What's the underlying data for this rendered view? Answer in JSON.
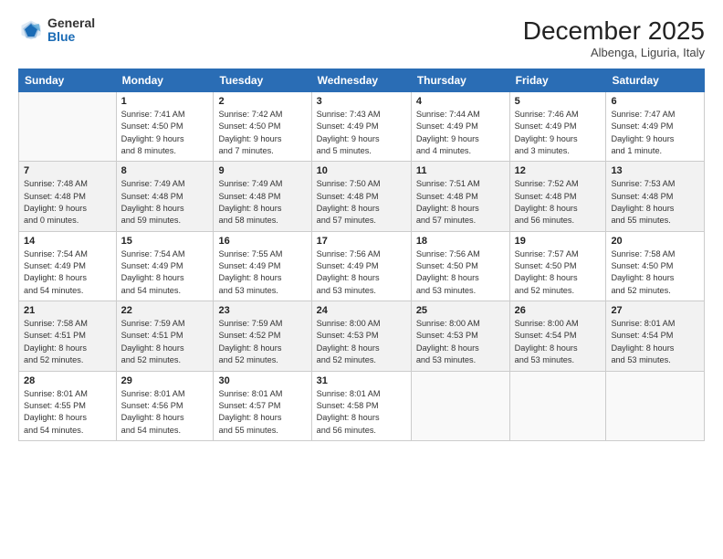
{
  "header": {
    "logo_general": "General",
    "logo_blue": "Blue",
    "month_title": "December 2025",
    "location": "Albenga, Liguria, Italy"
  },
  "days_of_week": [
    "Sunday",
    "Monday",
    "Tuesday",
    "Wednesday",
    "Thursday",
    "Friday",
    "Saturday"
  ],
  "weeks": [
    [
      {
        "day": "",
        "info": ""
      },
      {
        "day": "1",
        "info": "Sunrise: 7:41 AM\nSunset: 4:50 PM\nDaylight: 9 hours\nand 8 minutes."
      },
      {
        "day": "2",
        "info": "Sunrise: 7:42 AM\nSunset: 4:50 PM\nDaylight: 9 hours\nand 7 minutes."
      },
      {
        "day": "3",
        "info": "Sunrise: 7:43 AM\nSunset: 4:49 PM\nDaylight: 9 hours\nand 5 minutes."
      },
      {
        "day": "4",
        "info": "Sunrise: 7:44 AM\nSunset: 4:49 PM\nDaylight: 9 hours\nand 4 minutes."
      },
      {
        "day": "5",
        "info": "Sunrise: 7:46 AM\nSunset: 4:49 PM\nDaylight: 9 hours\nand 3 minutes."
      },
      {
        "day": "6",
        "info": "Sunrise: 7:47 AM\nSunset: 4:49 PM\nDaylight: 9 hours\nand 1 minute."
      }
    ],
    [
      {
        "day": "7",
        "info": "Sunrise: 7:48 AM\nSunset: 4:48 PM\nDaylight: 9 hours\nand 0 minutes."
      },
      {
        "day": "8",
        "info": "Sunrise: 7:49 AM\nSunset: 4:48 PM\nDaylight: 8 hours\nand 59 minutes."
      },
      {
        "day": "9",
        "info": "Sunrise: 7:49 AM\nSunset: 4:48 PM\nDaylight: 8 hours\nand 58 minutes."
      },
      {
        "day": "10",
        "info": "Sunrise: 7:50 AM\nSunset: 4:48 PM\nDaylight: 8 hours\nand 57 minutes."
      },
      {
        "day": "11",
        "info": "Sunrise: 7:51 AM\nSunset: 4:48 PM\nDaylight: 8 hours\nand 57 minutes."
      },
      {
        "day": "12",
        "info": "Sunrise: 7:52 AM\nSunset: 4:48 PM\nDaylight: 8 hours\nand 56 minutes."
      },
      {
        "day": "13",
        "info": "Sunrise: 7:53 AM\nSunset: 4:48 PM\nDaylight: 8 hours\nand 55 minutes."
      }
    ],
    [
      {
        "day": "14",
        "info": "Sunrise: 7:54 AM\nSunset: 4:49 PM\nDaylight: 8 hours\nand 54 minutes."
      },
      {
        "day": "15",
        "info": "Sunrise: 7:54 AM\nSunset: 4:49 PM\nDaylight: 8 hours\nand 54 minutes."
      },
      {
        "day": "16",
        "info": "Sunrise: 7:55 AM\nSunset: 4:49 PM\nDaylight: 8 hours\nand 53 minutes."
      },
      {
        "day": "17",
        "info": "Sunrise: 7:56 AM\nSunset: 4:49 PM\nDaylight: 8 hours\nand 53 minutes."
      },
      {
        "day": "18",
        "info": "Sunrise: 7:56 AM\nSunset: 4:50 PM\nDaylight: 8 hours\nand 53 minutes."
      },
      {
        "day": "19",
        "info": "Sunrise: 7:57 AM\nSunset: 4:50 PM\nDaylight: 8 hours\nand 52 minutes."
      },
      {
        "day": "20",
        "info": "Sunrise: 7:58 AM\nSunset: 4:50 PM\nDaylight: 8 hours\nand 52 minutes."
      }
    ],
    [
      {
        "day": "21",
        "info": "Sunrise: 7:58 AM\nSunset: 4:51 PM\nDaylight: 8 hours\nand 52 minutes."
      },
      {
        "day": "22",
        "info": "Sunrise: 7:59 AM\nSunset: 4:51 PM\nDaylight: 8 hours\nand 52 minutes."
      },
      {
        "day": "23",
        "info": "Sunrise: 7:59 AM\nSunset: 4:52 PM\nDaylight: 8 hours\nand 52 minutes."
      },
      {
        "day": "24",
        "info": "Sunrise: 8:00 AM\nSunset: 4:53 PM\nDaylight: 8 hours\nand 52 minutes."
      },
      {
        "day": "25",
        "info": "Sunrise: 8:00 AM\nSunset: 4:53 PM\nDaylight: 8 hours\nand 53 minutes."
      },
      {
        "day": "26",
        "info": "Sunrise: 8:00 AM\nSunset: 4:54 PM\nDaylight: 8 hours\nand 53 minutes."
      },
      {
        "day": "27",
        "info": "Sunrise: 8:01 AM\nSunset: 4:54 PM\nDaylight: 8 hours\nand 53 minutes."
      }
    ],
    [
      {
        "day": "28",
        "info": "Sunrise: 8:01 AM\nSunset: 4:55 PM\nDaylight: 8 hours\nand 54 minutes."
      },
      {
        "day": "29",
        "info": "Sunrise: 8:01 AM\nSunset: 4:56 PM\nDaylight: 8 hours\nand 54 minutes."
      },
      {
        "day": "30",
        "info": "Sunrise: 8:01 AM\nSunset: 4:57 PM\nDaylight: 8 hours\nand 55 minutes."
      },
      {
        "day": "31",
        "info": "Sunrise: 8:01 AM\nSunset: 4:58 PM\nDaylight: 8 hours\nand 56 minutes."
      },
      {
        "day": "",
        "info": ""
      },
      {
        "day": "",
        "info": ""
      },
      {
        "day": "",
        "info": ""
      }
    ]
  ]
}
